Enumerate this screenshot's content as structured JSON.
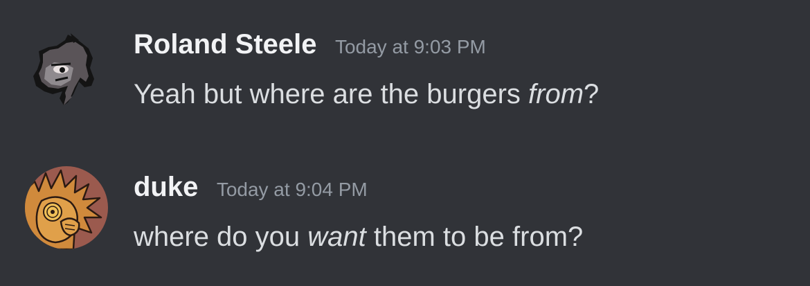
{
  "messages": [
    {
      "author": "Roland Steele",
      "timestamp": "Today at 9:03 PM",
      "content": {
        "before": "Yeah but where are the burgers ",
        "emphasis": "from",
        "after": "?"
      },
      "avatar": {
        "icon": "pixel-creature-avatar",
        "colors": [
          "#5a5458",
          "#8f8a8e",
          "#141414",
          "#e8e0e0"
        ]
      }
    },
    {
      "author": "duke",
      "timestamp": "Today at 9:04 PM",
      "content": {
        "before": "where do you ",
        "emphasis": "want",
        "after": " them to be from?"
      },
      "avatar": {
        "icon": "cartoon-character-avatar",
        "colors": [
          "#9b5a4e",
          "#d08a3c",
          "#f0c058",
          "#2b1a12"
        ]
      }
    }
  ]
}
